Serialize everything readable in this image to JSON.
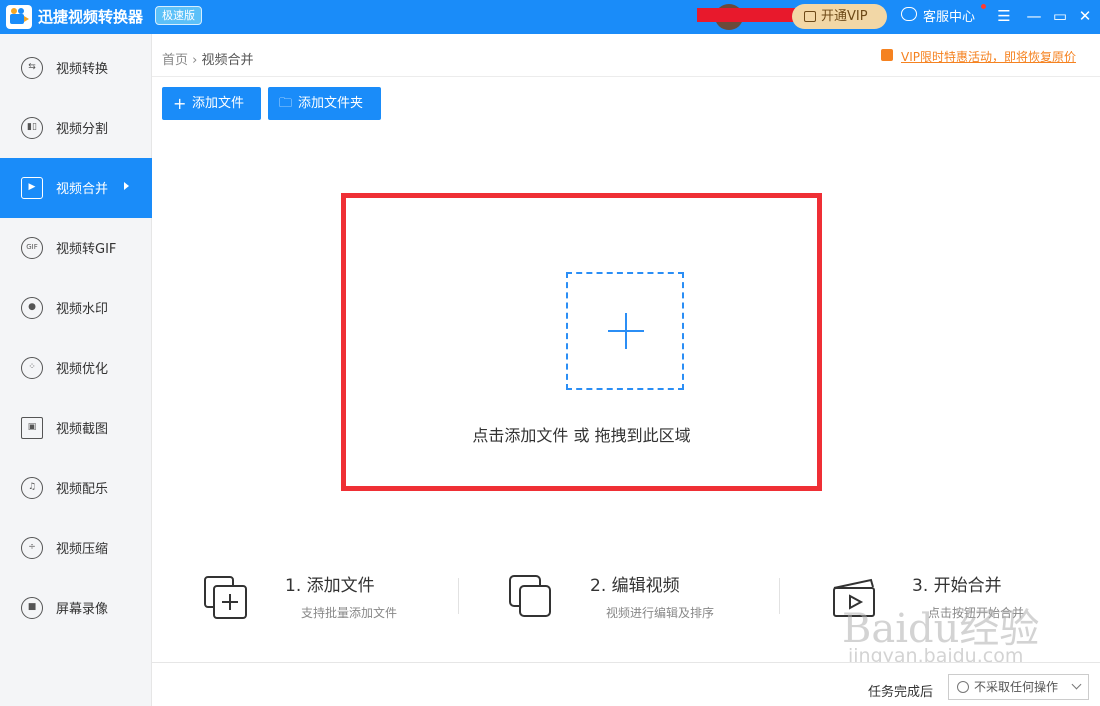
{
  "colors": {
    "brand": "#1a8cf9",
    "highlight": "#ef2f35",
    "promo": "#f58220",
    "vip": "#f2d7a6"
  },
  "titlebar": {
    "title": "迅捷视频转换器",
    "badge": "极速版",
    "vip": "开通VIP",
    "service": "客服中心",
    "menu_icon": "menu-icon",
    "min_icon": "minimize-icon",
    "max_icon": "maximize-icon",
    "close_icon": "close-icon",
    "menu_glyph": "☰",
    "min_glyph": "—",
    "max_glyph": "▭",
    "close_glyph": "✕"
  },
  "sidebar": {
    "items": [
      {
        "label": "视频转换",
        "icon": "convert-icon",
        "glyph": "⇆"
      },
      {
        "label": "视频分割",
        "icon": "split-icon",
        "glyph": "▮▯"
      },
      {
        "label": "视频合并",
        "icon": "merge-icon",
        "glyph": "▶",
        "active": true
      },
      {
        "label": "视频转GIF",
        "icon": "gif-icon",
        "glyph": "GIF"
      },
      {
        "label": "视频水印",
        "icon": "watermark-icon",
        "glyph": "●"
      },
      {
        "label": "视频优化",
        "icon": "optimize-icon",
        "glyph": "⁘"
      },
      {
        "label": "视频截图",
        "icon": "screenshot-icon",
        "glyph": "▣"
      },
      {
        "label": "视频配乐",
        "icon": "music-icon",
        "glyph": "♫"
      },
      {
        "label": "视频压缩",
        "icon": "compress-icon",
        "glyph": "÷"
      },
      {
        "label": "屏幕录像",
        "icon": "record-icon",
        "glyph": "■"
      }
    ]
  },
  "breadcrumb": {
    "home": "首页",
    "sep": "›",
    "current": "视频合并"
  },
  "promo": "VIP限时特惠活动，即将恢复原价",
  "toolbar": {
    "add_file": "添加文件",
    "add_file_glyph": "+",
    "add_folder": "添加文件夹",
    "add_folder_glyph": "🗀"
  },
  "dropzone": {
    "text": "点击添加文件 或 拖拽到此区域"
  },
  "steps": [
    {
      "title": "1. 添加文件",
      "desc": "支持批量添加文件",
      "icon": "add-file-icon"
    },
    {
      "title": "2. 编辑视频",
      "desc": "视频进行编辑及排序",
      "icon": "edit-video-icon"
    },
    {
      "title": "3. 开始合并",
      "desc": "点击按钮开始合并",
      "icon": "start-merge-icon"
    }
  ],
  "footer": {
    "label": "任务完成后",
    "select_value": "不采取任何操作"
  },
  "watermark": {
    "logo": "Baidu经验",
    "url": "jingyan.baidu.com"
  }
}
